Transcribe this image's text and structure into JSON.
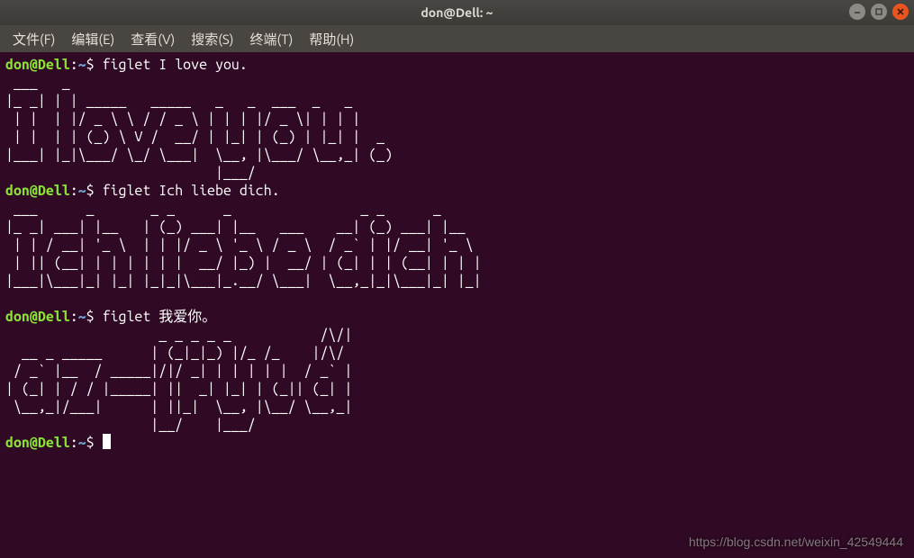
{
  "window": {
    "title": "don@Dell: ~"
  },
  "menubar": {
    "items": [
      "文件(F)",
      "编辑(E)",
      "查看(V)",
      "搜索(S)",
      "终端(T)",
      "帮助(H)"
    ]
  },
  "prompt": {
    "user": "don",
    "at": "@",
    "host": "Dell",
    "colon": ":",
    "path": "~",
    "dollar": "$ "
  },
  "commands": {
    "c1": "figlet I love you.",
    "c2": "figlet Ich liebe dich.",
    "c3": "figlet 我爱你。",
    "c4": ""
  },
  "ascii": {
    "a1": " ___   _                                        \n|_ _| | | _____   _____   _   _  ___  _   _     \n | |  | |/ _ \\ \\ / / _ \\ | | | |/ _ \\| | | |    \n | |  | | (_) \\ V /  __/ | |_| | (_) | |_| |  _ \n|___| |_|\\___/ \\_/ \\___|  \\__, |\\___/ \\__,_| (_)\n                          |___/                 ",
    "a2": " ___      _       _ _      _                _ _      _     \n|_ _| ___| |__   | (_) ___| |__   ___    __| (_) ___| |__  \n | | / __| '_ \\  | | |/ _ \\ '_ \\ / _ \\  / _` | |/ __| '_ \\ \n | || (__| | | | | | |  __/ |_) |  __/ | (_| | | (__| | | |\n|___|\\___|_| |_| |_|_|\\___|_.__/ \\___|  \\__,_|_|\\___|_| |_|\n                                                           ",
    "a3": "                   _ _ _ _ _           /\\/|\n  __ _ _____      | (_|_|_) |/_ /_    |/\\/ \n / _` |__  / _____|/|/ _| | | | | |  / _` |\n| (_| | / / |_____| ||  _| |_| | (_|| (_| |\n \\__,_|/___|      | ||_|  \\__, |\\__/ \\__,_|\n                  |__/    |___/            "
  },
  "watermark": "https://blog.csdn.net/weixin_42549444"
}
